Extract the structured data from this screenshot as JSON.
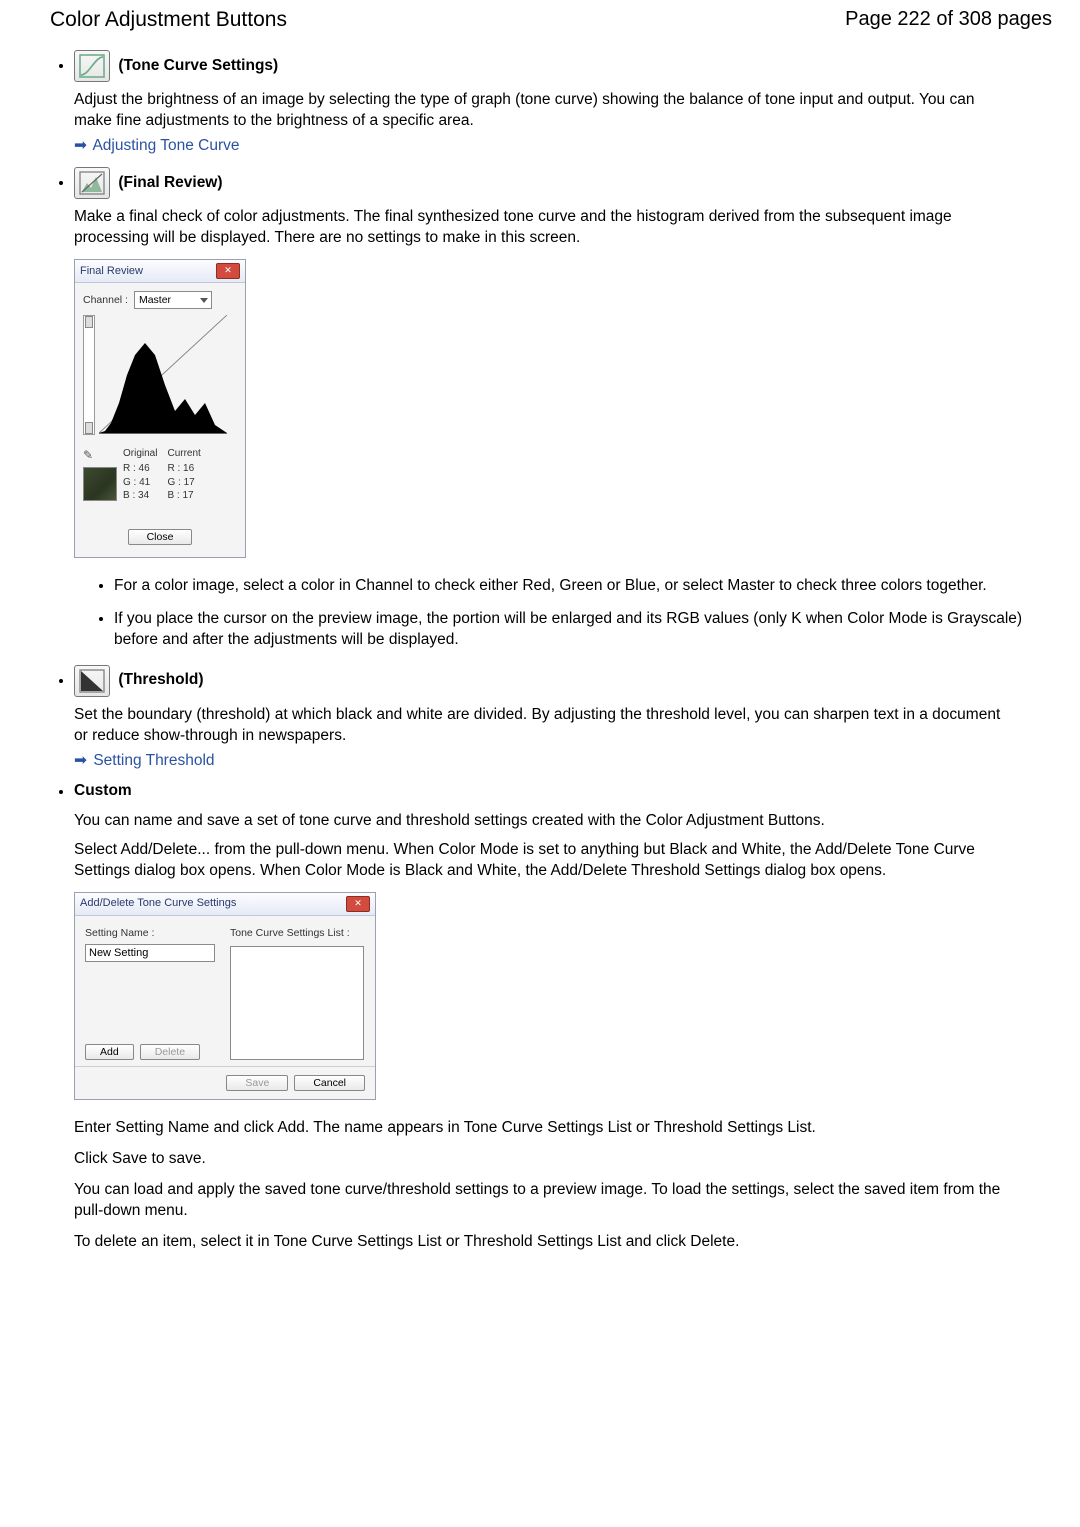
{
  "header": {
    "left": "Color Adjustment Buttons",
    "right": "Page 222 of 308 pages"
  },
  "toneCurve": {
    "title": "(Tone Curve Settings)",
    "desc": "Adjust the brightness of an image by selecting the type of graph (tone curve) showing the balance of tone input and output. You can make fine adjustments to the brightness of a specific area.",
    "link": "Adjusting Tone Curve"
  },
  "finalReview": {
    "title": "(Final Review)",
    "desc": "Make a final check of color adjustments. The final synthesized tone curve and the histogram derived from the subsequent image processing will be displayed. There are no settings to make in this screen.",
    "dialogTitle": "Final Review",
    "channelLabel": "Channel :",
    "channelValue": "Master",
    "orig": {
      "hdr": "Original",
      "r": "R :   46",
      "g": "G :   41",
      "b": "B :   34"
    },
    "curr": {
      "hdr": "Current",
      "r": "R :   16",
      "g": "G :   17",
      "b": "B :   17"
    },
    "closeLabel": "Close",
    "notes": [
      "For a color image, select a color in Channel to check either Red, Green or Blue, or select Master to check three colors together.",
      "If you place the cursor on the preview image, the portion will be enlarged and its RGB values (only K when Color Mode is Grayscale) before and after the adjustments will be displayed."
    ]
  },
  "threshold": {
    "title": "(Threshold)",
    "desc": "Set the boundary (threshold) at which black and white are divided. By adjusting the threshold level, you can sharpen text in a document or reduce show-through in newspapers.",
    "link": "Setting Threshold"
  },
  "custom": {
    "title": "Custom",
    "p1": "You can name and save a set of tone curve and threshold settings created with the Color Adjustment Buttons.",
    "p2": "Select Add/Delete... from the pull-down menu. When Color Mode is set to anything but Black and White, the Add/Delete Tone Curve Settings dialog box opens. When Color Mode is Black and White, the Add/Delete Threshold Settings dialog box opens.",
    "dlg": {
      "title": "Add/Delete Tone Curve Settings",
      "nameLabel": "Setting Name :",
      "nameValue": "New Setting",
      "listLabel": "Tone Curve Settings List :",
      "add": "Add",
      "del": "Delete",
      "save": "Save",
      "cancel": "Cancel"
    },
    "p3": "Enter Setting Name and click Add. The name appears in Tone Curve Settings List or Threshold Settings List.",
    "p4": "Click Save to save.",
    "p5": "You can load and apply the saved tone curve/threshold settings to a preview image. To load the settings, select the saved item from the pull-down menu.",
    "p6": "To delete an item, select it in Tone Curve Settings List or Threshold Settings List and click Delete."
  }
}
